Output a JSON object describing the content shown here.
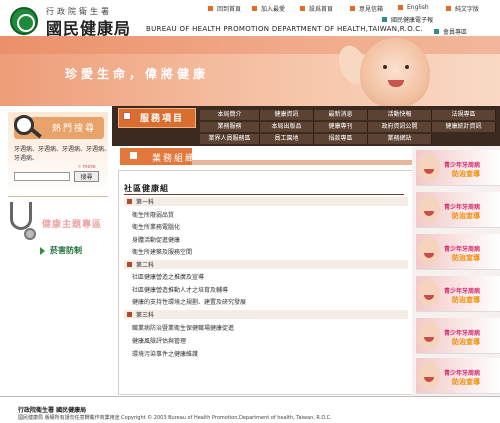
{
  "header": {
    "agency": "行政院衛生署",
    "bureau_cn": "國民健康局",
    "bureau_en": "BUREAU OF HEALTH PROMOTION DEPARTMENT OF HEALTH,TAIWAN,R.O.C.",
    "top_links": [
      "回到首頁",
      "加入最愛",
      "設爲首頁",
      "意見信箱",
      "English",
      "純文字版"
    ],
    "sub_links": [
      "國民健康電子報",
      "會員專區"
    ]
  },
  "banner": {
    "slogan": "珍愛生命，偉將健康"
  },
  "search": {
    "title": "熱門搜尋",
    "hot_words": "牙週病、牙週病、牙週病、牙週病、牙週病、",
    "more": "» more",
    "button": "搜尋",
    "input_value": ""
  },
  "health": {
    "title": "健康主題專區",
    "link": "菸害防制"
  },
  "nav": {
    "title": "服務項目",
    "row1": [
      "本局簡介",
      "健康資訊",
      "最新消息",
      "活動快報",
      "法規專區"
    ],
    "row2": [
      "業務服務",
      "本局出版品",
      "健康專刊",
      "政府資訊公開",
      "健康統計資訊"
    ],
    "row3": [
      "業界人員服務區",
      "員工園地",
      "捐款專區",
      "業務網站"
    ]
  },
  "main": {
    "section_tab": "業務組織",
    "group_title": "社區健康組",
    "sections": [
      {
        "label": "第一科",
        "items": [
          "衛生所廢弱品質",
          "衛生所業務電腦化",
          "身體活動促進健康",
          "衛生所建築及服務空間"
        ]
      },
      {
        "label": "第二科",
        "items": [
          "社區健康營造之推廣及宣導",
          "社區健康營造推動人才之培育及輔導",
          "健康的支持性環境之規劃、建置及研究發展"
        ]
      },
      {
        "label": "第三科",
        "items": [
          "職業病防治暨業衛生保健職場健康促進",
          "健康風險評估與管理",
          "環境污染事件之健康維護"
        ]
      }
    ]
  },
  "promos": [
    {
      "t1": "青少年牙周病",
      "t2": "防治宣導"
    },
    {
      "t1": "青少年牙周病",
      "t2": "防治宣導"
    },
    {
      "t1": "青少年牙周病",
      "t2": "防治宣導"
    },
    {
      "t1": "青少年牙周病",
      "t2": "防治宣導"
    },
    {
      "t1": "青少年牙周病",
      "t2": "防治宣導"
    },
    {
      "t1": "青少年牙周病",
      "t2": "防治宣導"
    }
  ],
  "footer": {
    "line1": "行政院衛生署 國民健康局",
    "line2": "國民健康局 版權所有請勿任意轉載作商業用途 Copyright © 2003 Bureau of Health Promotion,Department of health, Taiwan, R.O.C."
  },
  "colors": {
    "accent": "#e2783b",
    "nav_bg": "#3a2a1f",
    "promo_title": "#d62b6b"
  }
}
